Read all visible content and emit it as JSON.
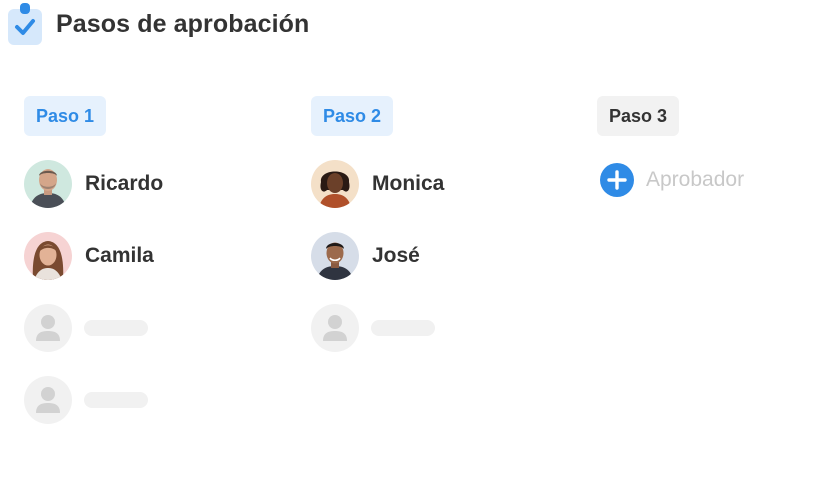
{
  "header": {
    "title": "Pasos de aprobación",
    "icon": "clipboard-check-icon"
  },
  "colors": {
    "accent": "#2f8be6",
    "accent_bg": "#e6f1fd",
    "text": "#333333",
    "placeholder": "#f1f1f1",
    "muted_text": "#c8c8c8"
  },
  "steps": [
    {
      "label": "Paso 1",
      "state": "active",
      "approvers": [
        {
          "name": "Ricardo",
          "avatar_bg": "#cfe8df"
        },
        {
          "name": "Camila",
          "avatar_bg": "#f6d3d3"
        }
      ],
      "empty_slots": 2
    },
    {
      "label": "Paso 2",
      "state": "active",
      "approvers": [
        {
          "name": "Monica",
          "avatar_bg": "#f4e0c8"
        },
        {
          "name": "José",
          "avatar_bg": "#d6dde8"
        }
      ],
      "empty_slots": 1
    },
    {
      "label": "Paso 3",
      "state": "inactive",
      "approvers": [],
      "add_label": "Aprobador"
    }
  ]
}
